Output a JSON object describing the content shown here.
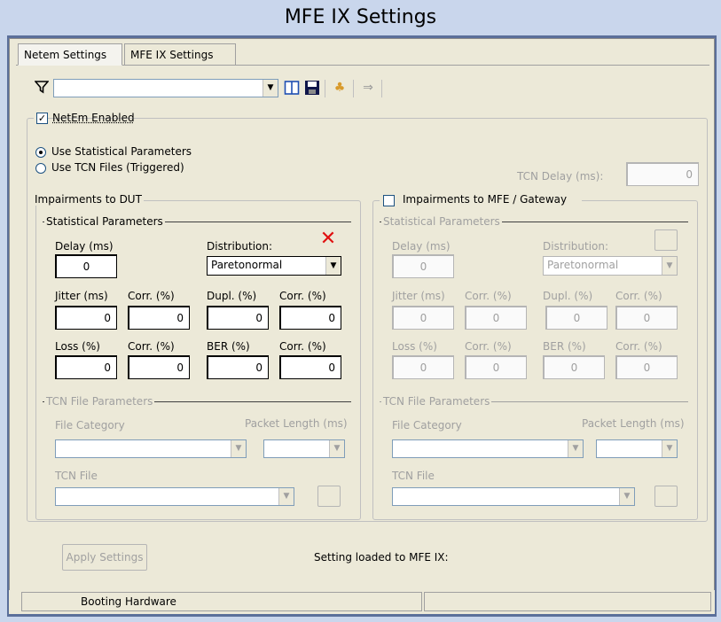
{
  "window": {
    "title": "MFE IX Settings"
  },
  "tabs": [
    {
      "label": "Netem Settings",
      "active": true
    },
    {
      "label": "MFE IX Settings",
      "active": false
    }
  ],
  "toolbar": {
    "filter_value": "",
    "icons": [
      "filter-icon",
      "columns-icon",
      "save-icon",
      "cursor-icon",
      "arrow-right-icon"
    ]
  },
  "netem": {
    "enabled_label": "NetEm Enabled",
    "enabled": true,
    "radio_statistical": "Use Statistical Parameters",
    "radio_tcn": "Use TCN Files (Triggered)",
    "tcn_delay_label": "TCN Delay (ms):",
    "tcn_delay_value": "0"
  },
  "dut": {
    "group_label": "Impairments to DUT",
    "stat_label": "Statistical Parameters",
    "delay_label": "Delay (ms)",
    "delay_value": "0",
    "distribution_label": "Distribution:",
    "distribution_value": "Paretonormal",
    "jitter_label": "Jitter (ms)",
    "jitter_value": "0",
    "corr1_label": "Corr. (%)",
    "corr1_value": "0",
    "dupl_label": "Dupl. (%)",
    "dupl_value": "0",
    "corr2_label": "Corr. (%)",
    "corr2_value": "0",
    "loss_label": "Loss (%)",
    "loss_value": "0",
    "corr3_label": "Corr. (%)",
    "corr3_value": "0",
    "ber_label": "BER (%)",
    "ber_value": "0",
    "corr4_label": "Corr. (%)",
    "corr4_value": "0",
    "tcn_params_label": "TCN File Parameters",
    "file_category_label": "File Category",
    "packet_length_label": "Packet Length (ms)",
    "tcn_file_label": "TCN File"
  },
  "mfe": {
    "group_label": "Impairments to MFE / Gateway",
    "enabled": false,
    "stat_label": "Statistical Parameters",
    "delay_label": "Delay (ms)",
    "delay_value": "0",
    "distribution_label": "Distribution:",
    "distribution_value": "Paretonormal",
    "jitter_label": "Jitter (ms)",
    "jitter_value": "0",
    "corr1_label": "Corr. (%)",
    "corr1_value": "0",
    "dupl_label": "Dupl. (%)",
    "dupl_value": "0",
    "corr2_label": "Corr. (%)",
    "corr2_value": "0",
    "loss_label": "Loss (%)",
    "loss_value": "0",
    "corr3_label": "Corr. (%)",
    "corr3_value": "0",
    "ber_label": "BER (%)",
    "ber_value": "0",
    "corr4_label": "Corr. (%)",
    "corr4_value": "0",
    "tcn_params_label": "TCN File Parameters",
    "file_category_label": "File Category",
    "packet_length_label": "Packet Length (ms)",
    "tcn_file_label": "TCN File"
  },
  "footer": {
    "apply_label": "Apply Settings",
    "loaded_text": "Setting loaded to MFE IX:"
  },
  "status": {
    "text": "Booting Hardware"
  }
}
